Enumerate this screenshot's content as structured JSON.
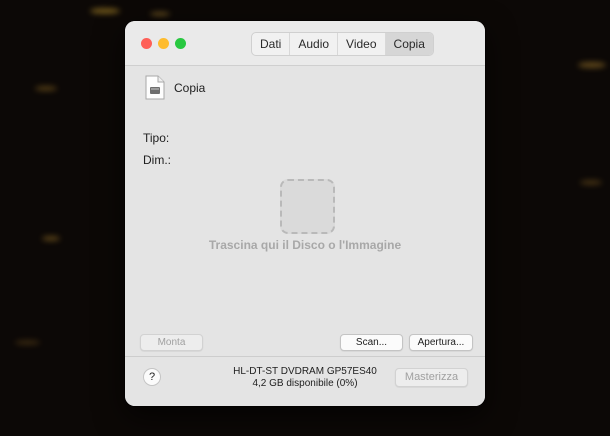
{
  "window": {
    "tabs": [
      {
        "label": "Dati"
      },
      {
        "label": "Audio"
      },
      {
        "label": "Video"
      },
      {
        "label": "Copia",
        "active": true
      }
    ]
  },
  "source": {
    "name": "Copia",
    "type_label": "Tipo:",
    "size_label": "Dim.:"
  },
  "drop_zone": {
    "text": "Trascina qui il Disco o l'Immagine"
  },
  "buttons": {
    "mount": "Monta",
    "scan": "Scan...",
    "open": "Apertura...",
    "burn": "Masterizza",
    "help": "?"
  },
  "drive": {
    "model": "HL-DT-ST DVDRAM GP57ES40",
    "available": "4,2 GB disponibile (0%)"
  },
  "colors": {
    "close": "#fe5f57",
    "minimize": "#febc2e",
    "zoom": "#28c840"
  }
}
